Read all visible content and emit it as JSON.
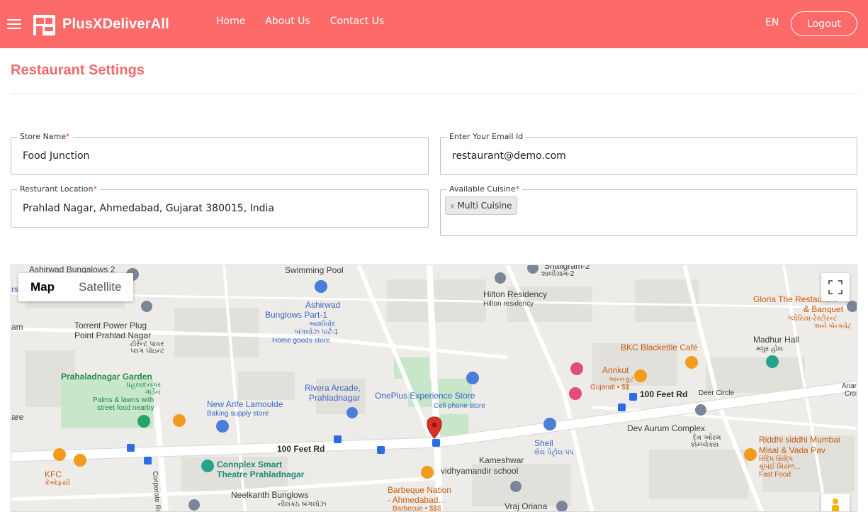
{
  "header": {
    "brand": "PlusXDeliverAll",
    "nav": [
      {
        "label": "Home"
      },
      {
        "label": "About Us"
      },
      {
        "label": "Contact Us"
      }
    ],
    "language": "EN",
    "logout_label": "Logout"
  },
  "page": {
    "title": "Restaurant Settings"
  },
  "form": {
    "store_name": {
      "label": "Store Name",
      "required": "*",
      "value": "Food Junction"
    },
    "email": {
      "label": "Enter Your Email Id",
      "value": "restaurant@demo.com"
    },
    "location": {
      "label": "Resturant Location",
      "required": "*",
      "value": "Prahlad Nagar, Ahmedabad, Gujarat 380015, India"
    },
    "cuisine": {
      "label": "Available Cuisine",
      "required": "*",
      "remove_glyph": "x",
      "selected": "Multi Cuisine"
    }
  },
  "map": {
    "toggle": {
      "map": "Map",
      "satellite": "Satellite"
    },
    "labels": {
      "swimming_pool": "Swimming Pool",
      "ashirwad_bungalows_2": "Ashirwad Bungalows 2",
      "ashirwad_part1_a": "Ashirwad",
      "ashirwad_part1_b": "Bunglows Part-1",
      "ashirwad_gu_a": "આશીર્વાદ",
      "ashirwad_gu_b": "બંગલોઝ પાર્ટ-1",
      "home_goods": "Home goods store",
      "torrent_a": "Torrent Power Plug",
      "torrent_b": "Point Prahlad Nagar",
      "torrent_gu_a": "ટોરેન્ટ પાવર",
      "torrent_gu_b": "પ્લગ પોઇન્ટ",
      "garden": "Prahaladnagar Garden",
      "garden_gu_a": "પ્રહલાદનગર",
      "garden_gu_b": "ગાર્ડન",
      "garden_sub_a": "Palms & lawns with",
      "garden_sub_b": "street food nearby",
      "arife": "New Arife Lamoulde",
      "arife_sub": "Baking supply store",
      "rivera_a": "Rivera Arcade,",
      "rivera_b": "Prahladnagar",
      "oneplus": "OnePlus Experience Store",
      "oneplus_sub": "Cell phone store",
      "shaligram": "Shaligram-2",
      "shaligram_gu": "શાલીગ્રામ-2",
      "hilton_a": "Hilton Residency",
      "hilton_b": "Hilton residency",
      "gloria_a": "Gloria The Restaurant",
      "gloria_b": "& Banquet",
      "gloria_gu_a": "ગ્લોરિયા-રેસ્ટોરન્ટ",
      "gloria_gu_b": "અને બેન્કવેટ",
      "madhur_a": "Madhur Hall",
      "madhur_b": "મધુર હોલ",
      "bkc": "BKC Blackettle Café",
      "annkut": "Annkut",
      "annkut_gu": "અન્નકૂટ",
      "annkut_sub": "Gujarati • $$",
      "road_100ft_right": "100 Feet Rd",
      "deer_circle": "Deer Circle",
      "anand_a": "Anan",
      "anand_b": "Cros",
      "dev_aurum": "Dev Aurum Complex",
      "dev_aurum_gu_a": "દેવ ઓરમ",
      "dev_aurum_gu_b": "કોમ્પ્લેક્સ",
      "riddhi_a": "Riddhi siddhi Mumbai",
      "riddhi_b": "Misal & Vada Pav",
      "riddhi_gu_a": "રિદ્ધિ સિદ્ધિ",
      "riddhi_gu_b": "મુંબઈ મિસળ...",
      "riddhi_sub": "Fast Food",
      "shell": "Shell",
      "shell_gu": "શેલ પેટ્રોલ પંપ",
      "kameshwar_a": "Kameshwar",
      "kameshwar_b": "vidhyamandir school",
      "road_100ft_left": "100 Feet Rd",
      "connplex_a": "Connplex Smart",
      "connplex_b": "Theatre Prahladnagar",
      "kfc": "KFC",
      "kfc_gu": "કેએફસી",
      "corporate_rd": "Corporate Rd",
      "neelkanth": "Neelkanth Bunglows",
      "neelkanth_gu": "નીલકંઠ બંગલોઝ",
      "barbeque_a": "Barbeque Nation",
      "barbeque_b": "- Ahmedabad...",
      "barbeque_sub": "Barbecue • $$$",
      "vraj": "Vraj Oriana",
      "edge_rs": "rs",
      "edge_am": "am",
      "edge_are": "are"
    }
  },
  "colors": {
    "header_bg": "#fc6a6a",
    "title": "#f26a6a",
    "pin": "#d93025"
  }
}
